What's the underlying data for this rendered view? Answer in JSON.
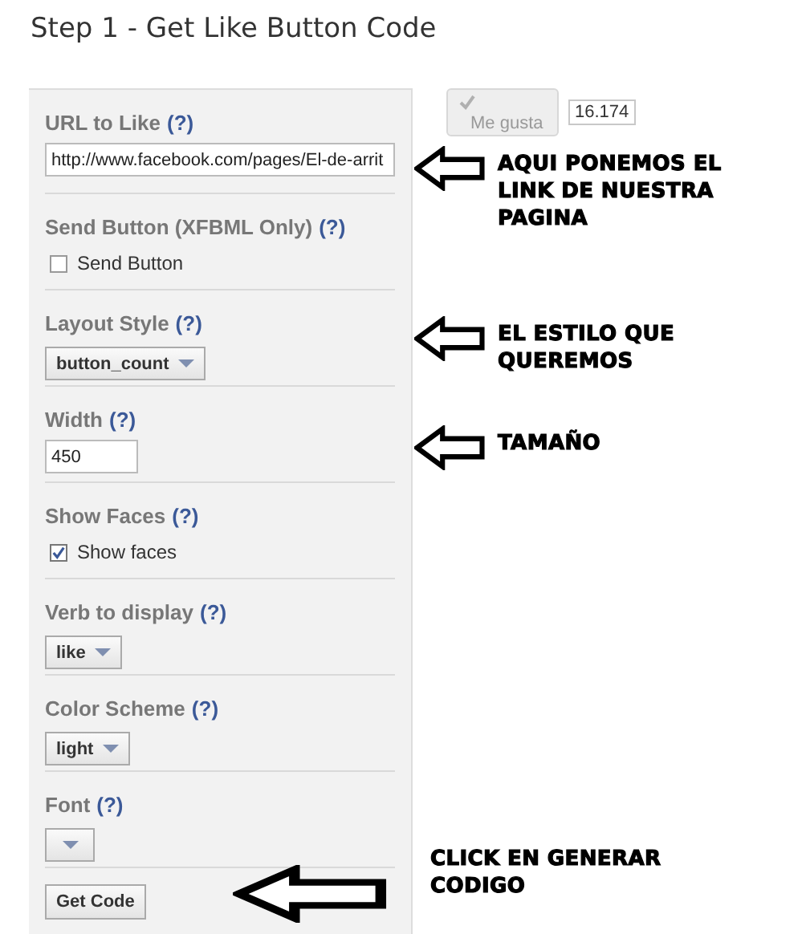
{
  "title": "Step 1 - Get Like Button Code",
  "preview": {
    "button": "Me gusta",
    "count": "16.174"
  },
  "sections": [
    {
      "kind": "text",
      "label": "URL to Like",
      "help": "(?)",
      "value": "http://www.facebook.com/pages/El-de-arrit",
      "note": "AQUI PONEMOS EL LINK DE NUESTRA PAGINA"
    },
    {
      "kind": "checkbox",
      "label": "Send Button (XFBML Only)",
      "help": "(?)",
      "option": "Send Button",
      "checked": false
    },
    {
      "kind": "select",
      "label": "Layout Style",
      "help": "(?)",
      "value": "button_count",
      "note": "EL ESTILO QUE QUEREMOS"
    },
    {
      "kind": "short",
      "label": "Width",
      "help": "(?)",
      "value": "450",
      "note": "TAMAÑO"
    },
    {
      "kind": "checkbox",
      "label": "Show Faces",
      "help": "(?)",
      "option": "Show faces",
      "checked": true
    },
    {
      "kind": "select",
      "label": "Verb to display",
      "help": "(?)",
      "value": "like"
    },
    {
      "kind": "select",
      "label": "Color Scheme",
      "help": "(?)",
      "value": "light"
    },
    {
      "kind": "select",
      "label": "Font",
      "help": "(?)"
    },
    {
      "kind": "button",
      "value": "Get Code",
      "note": "CLICK EN GENERAR CODIGO"
    }
  ]
}
